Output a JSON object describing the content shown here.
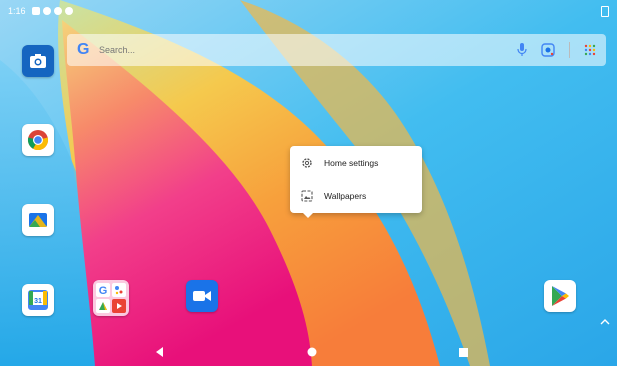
{
  "status_bar": {
    "time": "1:16",
    "icons": [
      "notification-icon",
      "chrome-notification-icon",
      "settings-notification-icon",
      "chrome-notification-icon"
    ]
  },
  "search": {
    "placeholder": "Search...",
    "logo": "G",
    "icons": [
      "mic-icon",
      "lens-icon",
      "apps-grid-icon"
    ]
  },
  "apps": [
    {
      "name": "camera-app",
      "icon": "camera-icon"
    },
    {
      "name": "chrome-app",
      "icon": "chrome-icon"
    },
    {
      "name": "files-app",
      "icon": "files-icon"
    },
    {
      "name": "calendar-app",
      "icon": "calendar-icon",
      "text": "31"
    },
    {
      "name": "google-folder",
      "icon": "folder-icon"
    },
    {
      "name": "meet-app",
      "icon": "video-icon"
    },
    {
      "name": "play-store-app",
      "icon": "play-store-icon"
    }
  ],
  "popup": {
    "items": [
      {
        "label": "Home settings",
        "icon": "gear-icon"
      },
      {
        "label": "Wallpapers",
        "icon": "wallpaper-icon"
      }
    ]
  },
  "nav": {
    "icons": [
      "back-icon",
      "home-icon",
      "recents-icon"
    ]
  },
  "colors": {
    "wallpaper_blue": "#3fb8ef",
    "wallpaper_pink": "#f0197a",
    "wallpaper_yellow": "#f3c64a",
    "wallpaper_orange": "#f59a3a",
    "google_blue": "#4285F4",
    "camera_blue": "#1565c0",
    "meet_blue": "#1a73e8"
  }
}
